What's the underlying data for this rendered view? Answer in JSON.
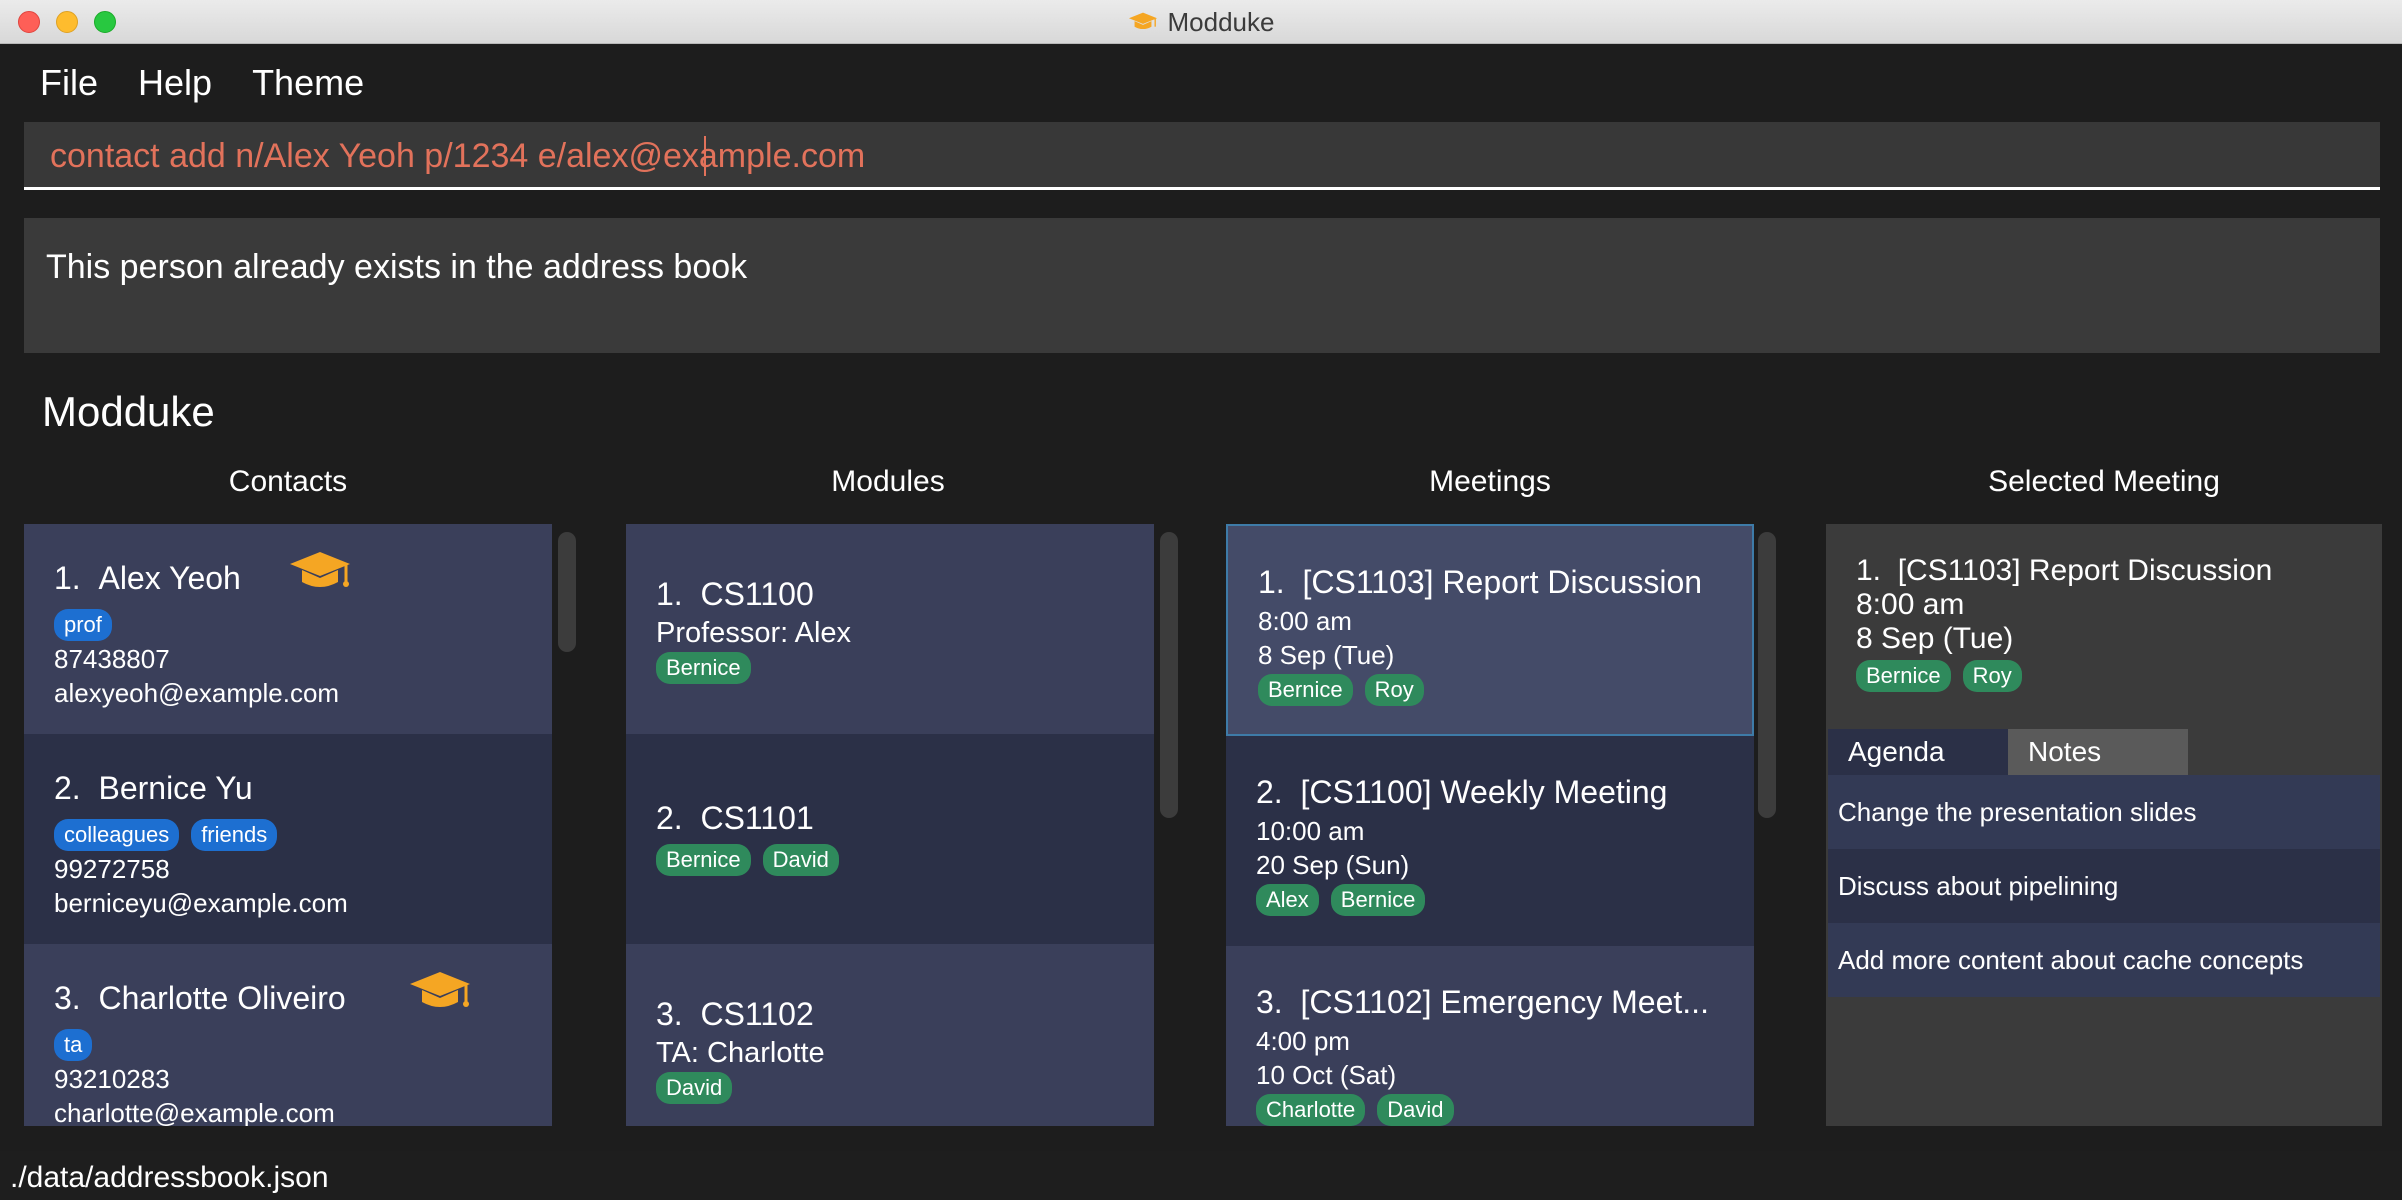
{
  "window": {
    "title": "Modduke"
  },
  "menu": [
    "File",
    "Help",
    "Theme"
  ],
  "command": {
    "value": "contact add n/Alex Yeoh p/1234 e/alex@example.com"
  },
  "result": {
    "text": "This person already exists in the address book"
  },
  "heading": "Modduke",
  "columns": {
    "contacts": "Contacts",
    "modules": "Modules",
    "meetings": "Meetings",
    "selected": "Selected Meeting"
  },
  "contacts": [
    {
      "index": "1.",
      "name": "Alex Yeoh",
      "tags": [
        "prof"
      ],
      "phone": "87438807",
      "email": "alexyeoh@example.com",
      "icon": "graduation-cap-icon"
    },
    {
      "index": "2.",
      "name": "Bernice Yu",
      "tags": [
        "colleagues",
        "friends"
      ],
      "phone": "99272758",
      "email": "berniceyu@example.com"
    },
    {
      "index": "3.",
      "name": "Charlotte Oliveiro",
      "tags": [
        "ta"
      ],
      "phone": "93210283",
      "email": "charlotte@example.com",
      "icon": "graduation-cap-icon"
    }
  ],
  "modules": [
    {
      "index": "1.",
      "code": "CS1100",
      "role": "Professor: Alex",
      "tags": [
        "Bernice"
      ]
    },
    {
      "index": "2.",
      "code": "CS1101",
      "role": "",
      "tags": [
        "Bernice",
        "David"
      ]
    },
    {
      "index": "3.",
      "code": "CS1102",
      "role": "TA: Charlotte",
      "tags": [
        "David"
      ]
    }
  ],
  "meetings": [
    {
      "index": "1.",
      "title": "[CS1103] Report Discussion",
      "time": "8:00 am",
      "date": "8 Sep (Tue)",
      "tags": [
        "Bernice",
        "Roy"
      ]
    },
    {
      "index": "2.",
      "title": "[CS1100] Weekly Meeting",
      "time": "10:00 am",
      "date": "20 Sep (Sun)",
      "tags": [
        "Alex",
        "Bernice"
      ]
    },
    {
      "index": "3.",
      "title": "[CS1102] Emergency Meet...",
      "time": "4:00 pm",
      "date": "10 Oct (Sat)",
      "tags": [
        "Charlotte",
        "David"
      ]
    }
  ],
  "selected_meeting": {
    "index": "1.",
    "title": "[CS1103] Report Discussion",
    "time": "8:00 am",
    "date": "8 Sep (Tue)",
    "tags": [
      "Bernice",
      "Roy"
    ],
    "tabs": [
      "Agenda",
      "Notes"
    ],
    "agenda": [
      "Change the presentation slides",
      "Discuss about pipelining",
      "Add more content about cache concepts"
    ]
  },
  "status": {
    "path": "./data/addressbook.json"
  },
  "colors": {
    "accent_command": "#e2725b",
    "tag_blue": "#1d6fd1",
    "tag_green": "#2f8a5c",
    "cap": "#f5a623"
  }
}
